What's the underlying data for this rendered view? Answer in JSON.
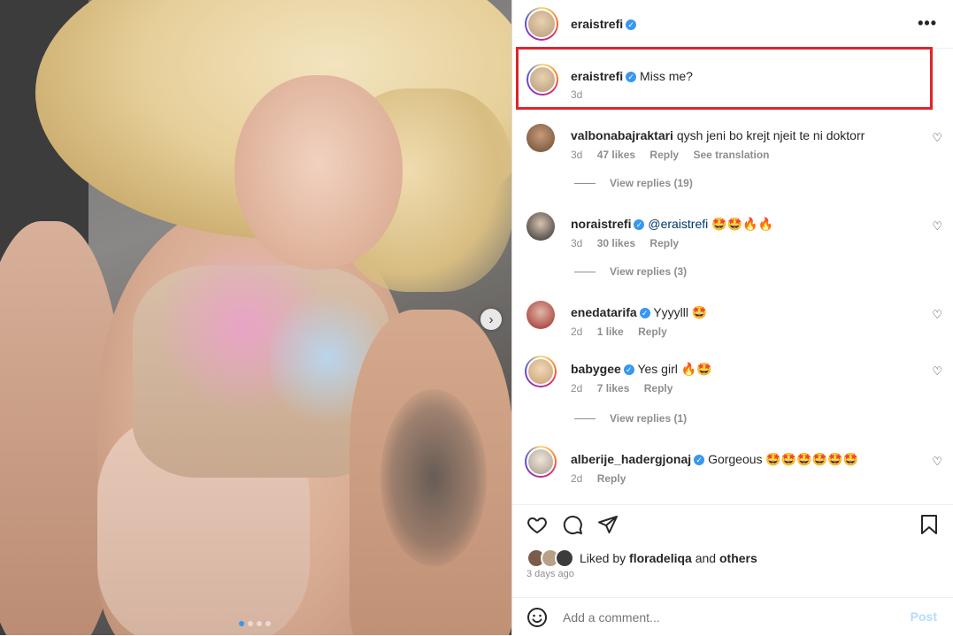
{
  "post": {
    "author": "eraistrefi",
    "more_label": "•••",
    "slide_count_active": 1,
    "next_label": "›"
  },
  "caption": {
    "username": "eraistrefi",
    "text": "Miss me?",
    "age": "3d"
  },
  "comments": [
    {
      "username": "valbonabajraktari",
      "verified": false,
      "text": "qysh jeni bo krejt njeit te ni doktorr",
      "age": "3d",
      "likes": "47 likes",
      "reply": "Reply",
      "translate": "See translation",
      "replies": "View replies (19)"
    },
    {
      "username": "noraistrefi",
      "verified": true,
      "mention": "@eraistrefi",
      "text": "🤩🤩🔥🔥",
      "age": "3d",
      "likes": "30 likes",
      "reply": "Reply",
      "replies": "View replies (3)"
    },
    {
      "username": "enedatarifa",
      "verified": true,
      "text": "Yyyylll 🤩",
      "age": "2d",
      "likes": "1 like",
      "reply": "Reply"
    },
    {
      "username": "babygee",
      "verified": true,
      "text": "Yes girl 🔥🤩",
      "age": "2d",
      "likes": "7 likes",
      "reply": "Reply",
      "replies": "View replies (1)"
    },
    {
      "username": "alberije_hadergjonaj",
      "verified": true,
      "text": "Gorgeous 🤩🤩🤩🤩🤩🤩",
      "age": "2d",
      "reply": "Reply"
    }
  ],
  "liked_by": {
    "prefix": "Liked by",
    "user": "floradeliqa",
    "and": "and",
    "others": "others"
  },
  "time_ago": "3 days ago",
  "add_comment": {
    "placeholder": "Add a comment...",
    "post_label": "Post"
  },
  "icons": {
    "like": "heart-icon",
    "comment": "comment-icon",
    "share": "send-icon",
    "save": "bookmark-icon",
    "emoji": "smiley-icon",
    "verified": "verified-badge-icon",
    "more": "more-options-icon"
  },
  "colors": {
    "verified": "#3897f0",
    "highlight_box": "#e0242b",
    "post_button": "#b3dbff",
    "muted": "#8e8e8e"
  }
}
